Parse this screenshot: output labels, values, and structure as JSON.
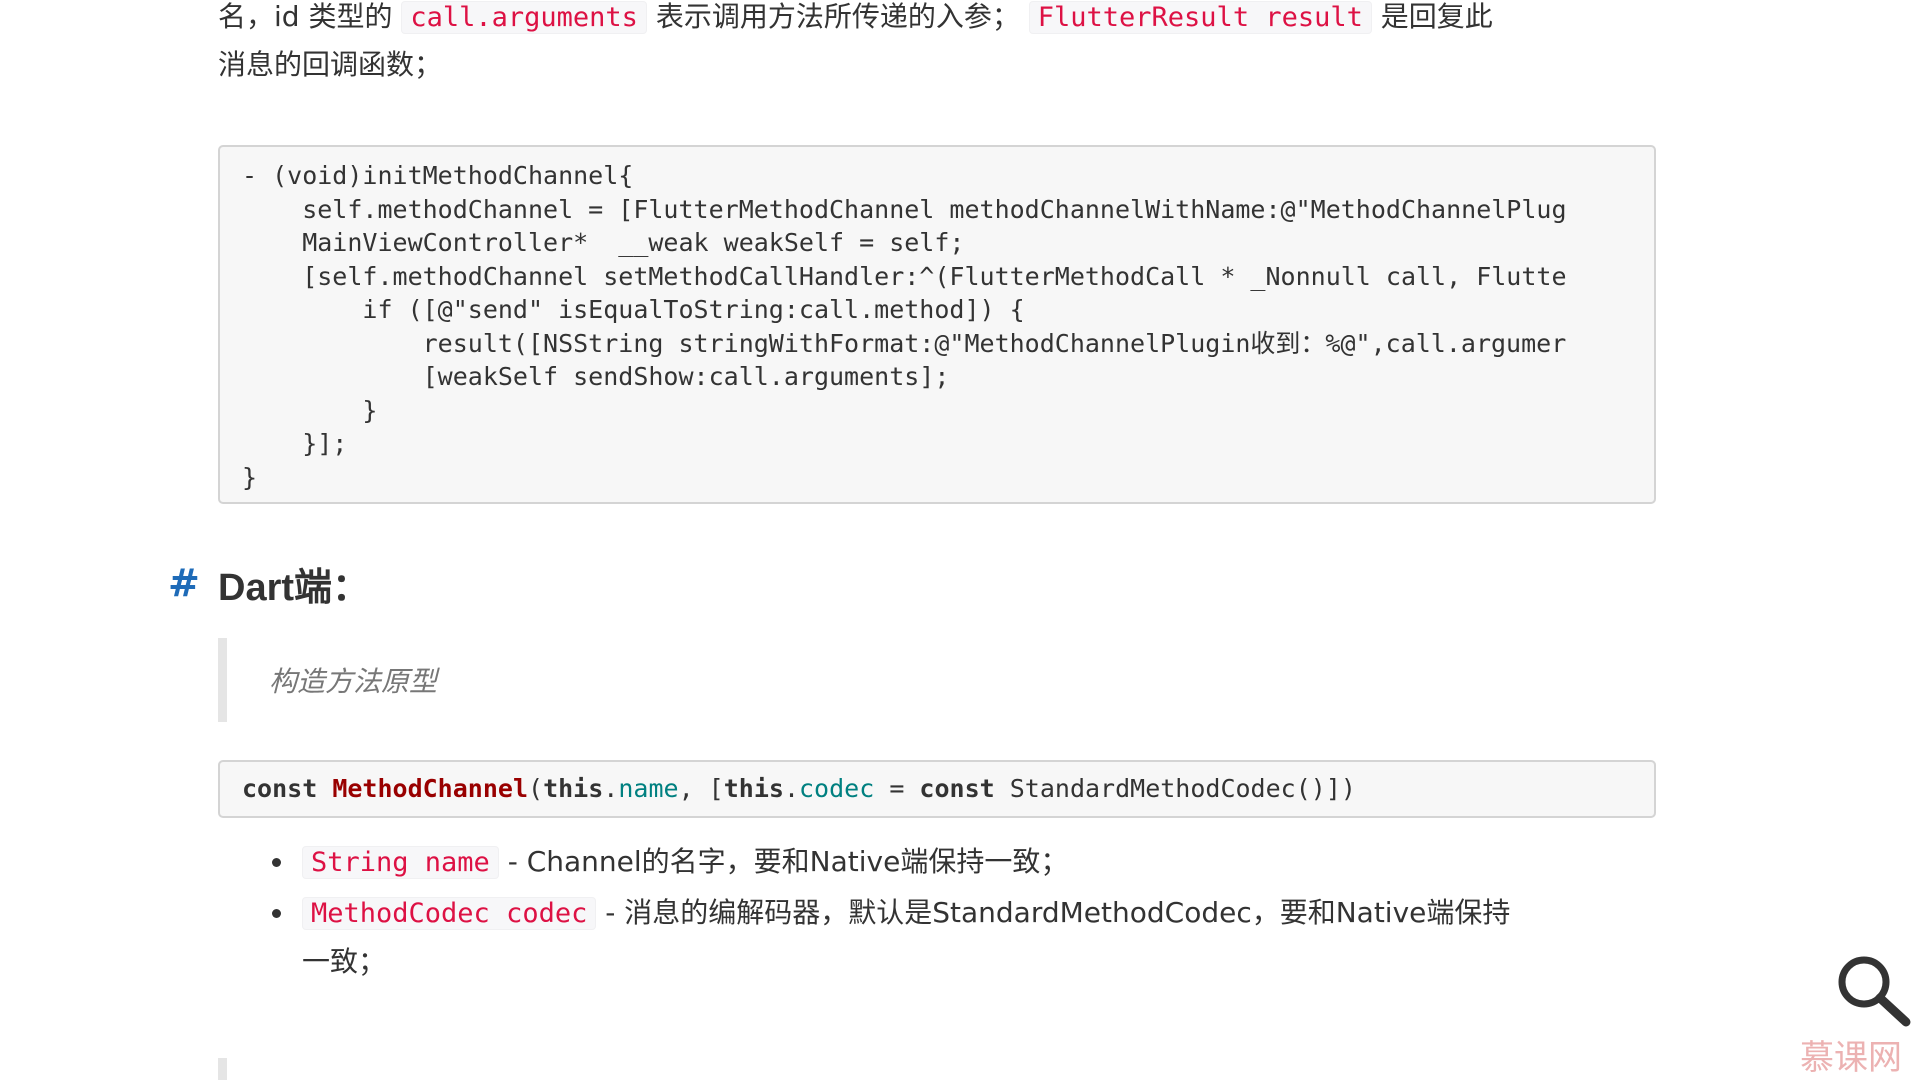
{
  "intro": {
    "line1_prefix": "名，id 类型的 ",
    "line1_code1": "call.arguments",
    "line1_mid": " 表示调用方法所传递的入参； ",
    "line1_code2": "FlutterResult result",
    "line1_suffix": " 是回复此",
    "line2": "消息的回调函数；"
  },
  "objc_code": {
    "lines": [
      "- (void)initMethodChannel{",
      "    self.methodChannel = [FlutterMethodChannel methodChannelWithName:@\"MethodChannelPlug",
      "    MainViewController*  __weak weakSelf = self;",
      "    [self.methodChannel setMethodCallHandler:^(FlutterMethodCall * _Nonnull call, Flutte",
      "        if ([@\"send\" isEqualToString:call.method]) {",
      "            result([NSString stringWithFormat:@\"MethodChannelPlugin收到：%@\",call.argumer",
      "            [weakSelf sendShow:call.arguments];",
      "        }",
      "    }];",
      "}"
    ]
  },
  "section": {
    "hash": "#",
    "title": "Dart端："
  },
  "blockquote": {
    "text": "构造方法原型"
  },
  "dart_code": {
    "kw_const1": "const",
    "class_name": "MethodChannel",
    "open_paren": "(",
    "kw_this1": "this",
    "dot_name": ".",
    "prop_name": "name",
    "comma_bracket": ", [",
    "kw_this2": "this",
    "dot_codec": ".",
    "prop_codec": "codec",
    "eq": " = ",
    "kw_const2": "const",
    "rest": " StandardMethodCodec()])"
  },
  "bullets": [
    {
      "code": "String name",
      "text": " - Channel的名字，要和Native端保持一致；"
    },
    {
      "code": "MethodCodec codec",
      "text": " - 消息的编解码器，默认是StandardMethodCodec，要和Native端保持",
      "text2": "一致；"
    }
  ],
  "watermark": {
    "text": "慕课网"
  },
  "colors": {
    "inline_code": "#dd1144",
    "heading_hash": "#1e6bb8",
    "class_name": "#990000",
    "property": "#008080"
  }
}
